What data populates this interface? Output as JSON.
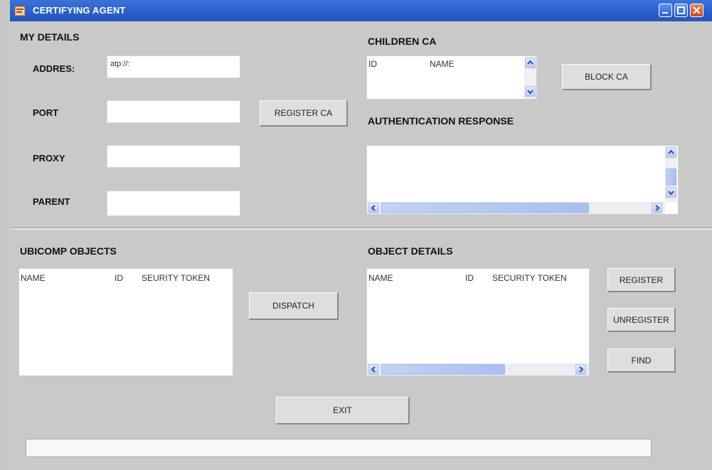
{
  "window": {
    "title": "CERTIFYING AGENT"
  },
  "my_details": {
    "heading": "MY DETAILS",
    "address_label": "ADDRES:",
    "address_value": "atp://:",
    "port_label": "PORT",
    "port_value": "",
    "proxy_label": "PROXY",
    "proxy_value": "",
    "parent_label": "PARENT",
    "parent_value": "",
    "register_ca_label": "REGISTER CA"
  },
  "children_ca": {
    "heading": "CHILDREN CA",
    "columns": [
      "ID",
      "NAME"
    ],
    "block_ca_label": "BLOCK CA"
  },
  "auth_response": {
    "heading": "AUTHENTICATION RESPONSE"
  },
  "ubicomp_objects": {
    "heading": "UBICOMP OBJECTS",
    "columns": [
      "NAME",
      "ID",
      "SEURITY TOKEN"
    ],
    "dispatch_label": "DISPATCH"
  },
  "object_details": {
    "heading": "OBJECT DETAILS",
    "columns": [
      "NAME",
      "ID",
      "SECURITY TOKEN"
    ],
    "register_label": "REGISTER",
    "unregister_label": "UNREGISTER",
    "find_label": "FIND"
  },
  "footer": {
    "exit_label": "EXIT",
    "status_text": ""
  },
  "colors": {
    "titlebar": "#2a5ec8",
    "window_bg": "#c9c9c9",
    "close_button": "#c9451f"
  },
  "icons": [
    "app-icon",
    "minimize-icon",
    "maximize-icon",
    "close-icon",
    "scroll-up-icon",
    "scroll-down-icon",
    "scroll-left-icon",
    "scroll-right-icon"
  ]
}
